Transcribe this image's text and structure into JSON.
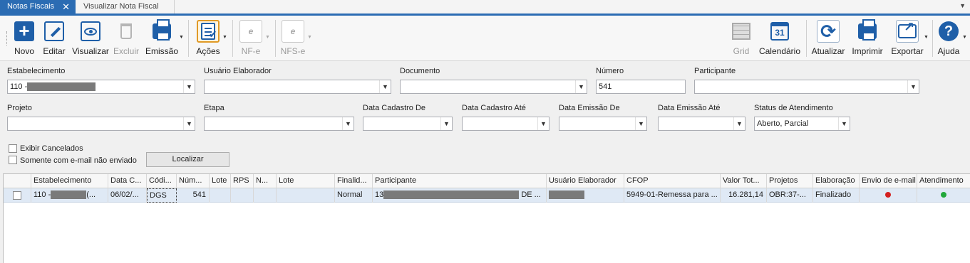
{
  "tabs": [
    {
      "label": "Notas Fiscais",
      "active": true
    },
    {
      "label": "Visualizar Nota Fiscal",
      "active": false
    }
  ],
  "toolbar": {
    "novo": "Novo",
    "editar": "Editar",
    "visualizar": "Visualizar",
    "excluir": "Excluir",
    "emissao": "Emissão",
    "acoes": "Ações",
    "nfe": "NF-e",
    "nfse": "NFS-e",
    "grid": "Grid",
    "calendario": "Calendário",
    "calendario_day": "31",
    "atualizar": "Atualizar",
    "imprimir": "Imprimir",
    "exportar": "Exportar",
    "ajuda": "Ajuda",
    "nfe_icon_text": "e"
  },
  "filters": {
    "estabelecimento": {
      "label": "Estabelecimento",
      "value": "110 -"
    },
    "usuario_elaborador": {
      "label": "Usuário Elaborador",
      "value": ""
    },
    "documento": {
      "label": "Documento",
      "value": ""
    },
    "numero": {
      "label": "Número",
      "value": "541"
    },
    "participante": {
      "label": "Participante",
      "value": ""
    },
    "projeto": {
      "label": "Projeto",
      "value": ""
    },
    "etapa": {
      "label": "Etapa",
      "value": ""
    },
    "data_cadastro_de": {
      "label": "Data Cadastro De",
      "value": ""
    },
    "data_cadastro_ate": {
      "label": "Data Cadastro Até",
      "value": ""
    },
    "data_emissao_de": {
      "label": "Data Emissão De",
      "value": ""
    },
    "data_emissao_ate": {
      "label": "Data Emissão Até",
      "value": ""
    },
    "status_atendimento": {
      "label": "Status de Atendimento",
      "value": "Aberto, Parcial"
    },
    "exibir_cancelados": "Exibir Cancelados",
    "somente_email": "Somente com e-mail não enviado",
    "localizar": "Localizar"
  },
  "grid": {
    "columns": [
      "Estabelecimento",
      "Data C...",
      "Códi...",
      "Núm...",
      "Lote",
      "RPS",
      "N...",
      "Lote",
      "Finalid...",
      "Participante",
      "Usuário Elaborador",
      "CFOP",
      "Valor Tot...",
      "Projetos",
      "Elaboração",
      "Envio de e-mail",
      "Atendimento"
    ],
    "rows": [
      {
        "estabelecimento": "110 -",
        "estabelecimento_suffix": "(...",
        "data": "06/02/...",
        "codigo": "DGS",
        "numero": "541",
        "lote": "",
        "rps": "",
        "n": "",
        "lote2": "",
        "finalidade": "Normal",
        "participante_prefix": "13",
        "participante_suffix": "DE ...",
        "usuario": "",
        "cfop": "5949-01-Remessa para ...",
        "valor": "16.281,14",
        "projetos": "OBR:37-...",
        "elaboracao": "Finalizado",
        "envio_email_status": "red",
        "atendimento_status": "green"
      }
    ]
  },
  "colors": {
    "accent": "#2b6cb3",
    "icon_blue": "#1f5fa8",
    "status_red": "#d42020",
    "status_green": "#21a83a"
  }
}
